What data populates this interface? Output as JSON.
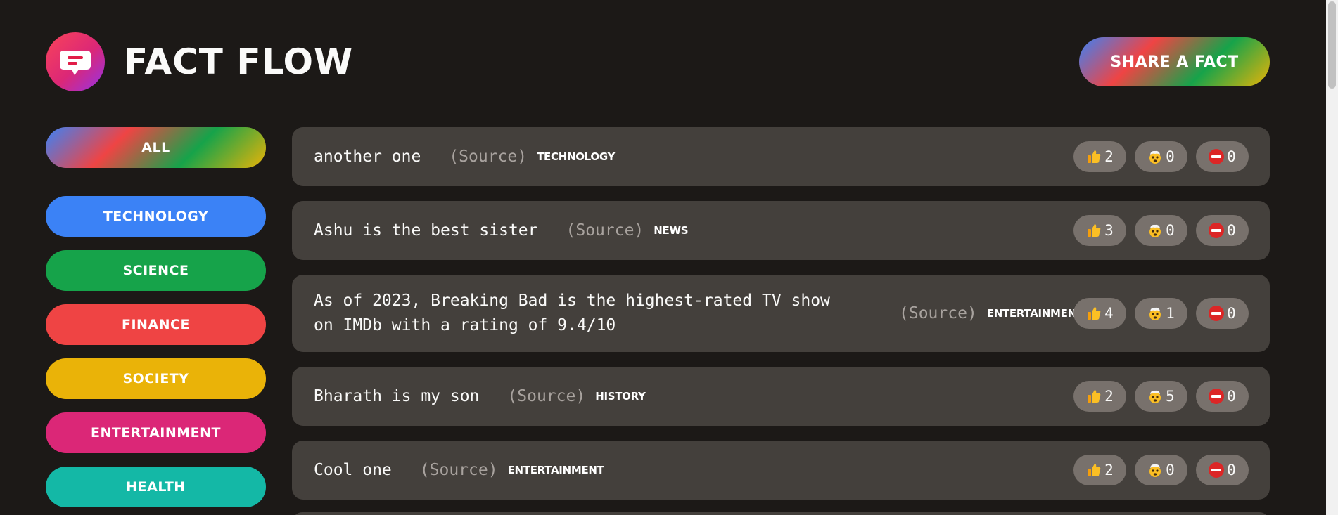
{
  "header": {
    "logo_icon": "message-icon",
    "brand_title": "FACT FLOW",
    "share_label": "SHARE A FACT"
  },
  "sidebar": {
    "all_label": "ALL",
    "categories": [
      {
        "label": "TECHNOLOGY",
        "color": "#3b82f6"
      },
      {
        "label": "SCIENCE",
        "color": "#16a34a"
      },
      {
        "label": "FINANCE",
        "color": "#ef4444"
      },
      {
        "label": "SOCIETY",
        "color": "#eab308"
      },
      {
        "label": "ENTERTAINMENT",
        "color": "#db2777"
      },
      {
        "label": "HEALTH",
        "color": "#14b8a6"
      }
    ]
  },
  "facts": [
    {
      "text": "another one",
      "source": "(Source)",
      "category": "TECHNOLOGY",
      "category_color": "#3b82f6",
      "likes": "2",
      "mindblowing": "0",
      "false": "0"
    },
    {
      "text": "Ashu is the best sister",
      "source": "(Source)",
      "category": "NEWS",
      "category_color": "#8b5cf6",
      "likes": "3",
      "mindblowing": "0",
      "false": "0"
    },
    {
      "text": "As of 2023, Breaking Bad is the highest-rated TV show on IMDb with a rating of 9.4/10",
      "source": "(Source)",
      "category": "ENTERTAINMENT",
      "category_color": "#db2777",
      "likes": "4",
      "mindblowing": "1",
      "false": "0"
    },
    {
      "text": "Bharath is my son",
      "source": "(Source)",
      "category": "HISTORY",
      "category_color": "#f97316",
      "likes": "2",
      "mindblowing": "5",
      "false": "0"
    },
    {
      "text": "Cool one",
      "source": "(Source)",
      "category": "ENTERTAINMENT",
      "category_color": "#db2777",
      "likes": "2",
      "mindblowing": "0",
      "false": "0"
    }
  ],
  "colors": {
    "background": "#1c1917",
    "card": "#44403c",
    "vote_button": "#78716c",
    "source_text": "#a8a29e"
  }
}
